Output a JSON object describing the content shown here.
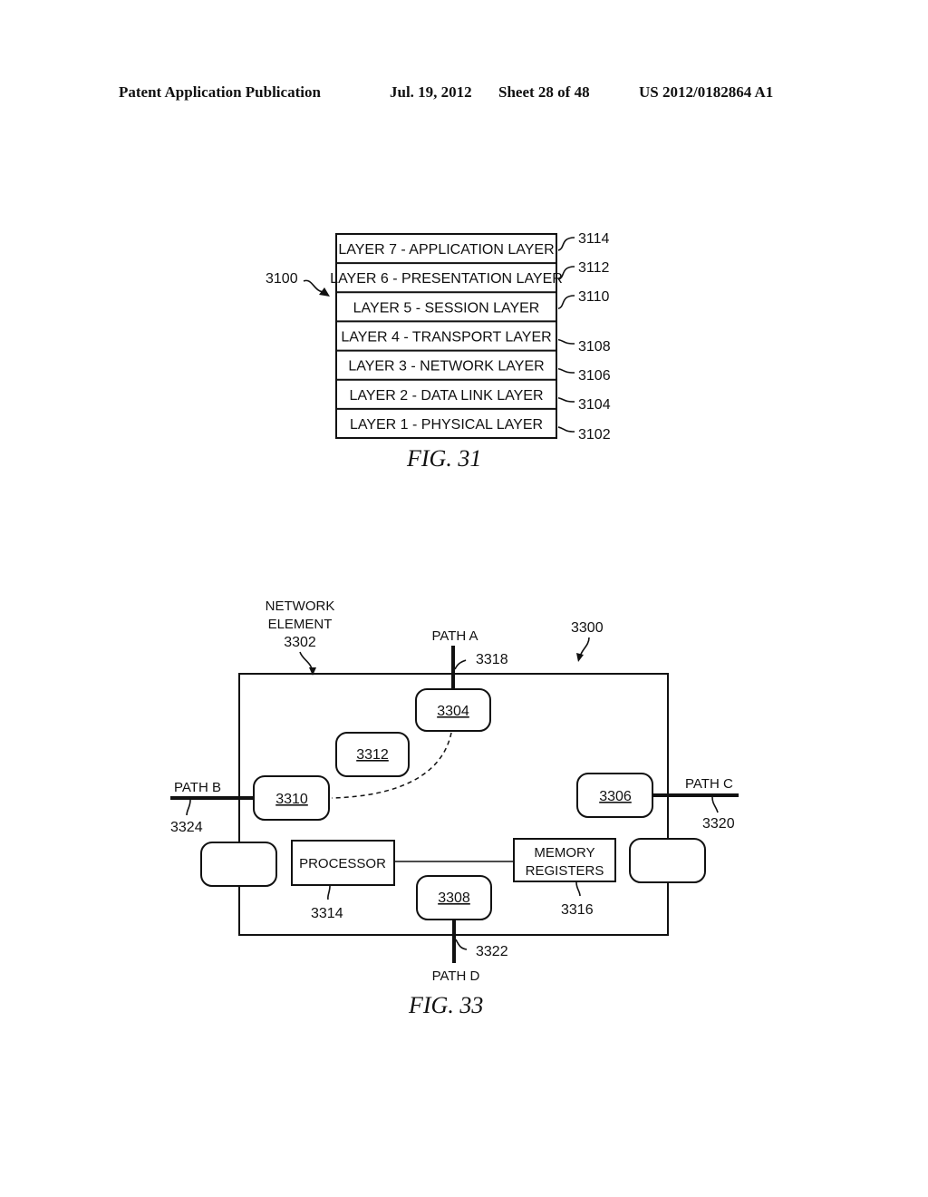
{
  "header": {
    "publication": "Patent Application Publication",
    "date": "Jul. 19, 2012",
    "sheet": "Sheet 28 of 48",
    "number": "US 2012/0182864 A1"
  },
  "fig31": {
    "caption": "FIG. 31",
    "ref": "3100",
    "layers": [
      {
        "label": "LAYER 7 - APPLICATION LAYER",
        "ref": "3114"
      },
      {
        "label": "LAYER 6 - PRESENTATION LAYER",
        "ref": "3112"
      },
      {
        "label": "LAYER 5 - SESSION LAYER",
        "ref": "3110"
      },
      {
        "label": "LAYER 4 - TRANSPORT LAYER",
        "ref": "3108"
      },
      {
        "label": "LAYER 3 - NETWORK LAYER",
        "ref": "3106"
      },
      {
        "label": "LAYER 2 - DATA LINK LAYER",
        "ref": "3104"
      },
      {
        "label": "LAYER 1 - PHYSICAL LAYER",
        "ref": "3102"
      }
    ]
  },
  "fig33": {
    "caption": "FIG. 33",
    "ref": "3300",
    "element_label_1": "NETWORK",
    "element_label_2": "ELEMENT",
    "element_ref": "3302",
    "ports": {
      "p3304": "3304",
      "p3306": "3306",
      "p3308": "3308",
      "p3310": "3310",
      "p3312": "3312"
    },
    "processor": {
      "label": "PROCESSOR",
      "ref": "3314"
    },
    "memory": {
      "label_1": "MEMORY",
      "label_2": "REGISTERS",
      "ref": "3316"
    },
    "paths": {
      "a": {
        "label": "PATH A",
        "ref": "3318"
      },
      "b": {
        "label": "PATH B",
        "ref": "3324"
      },
      "c": {
        "label": "PATH C",
        "ref": "3320"
      },
      "d": {
        "label": "PATH D",
        "ref": "3322"
      }
    }
  }
}
